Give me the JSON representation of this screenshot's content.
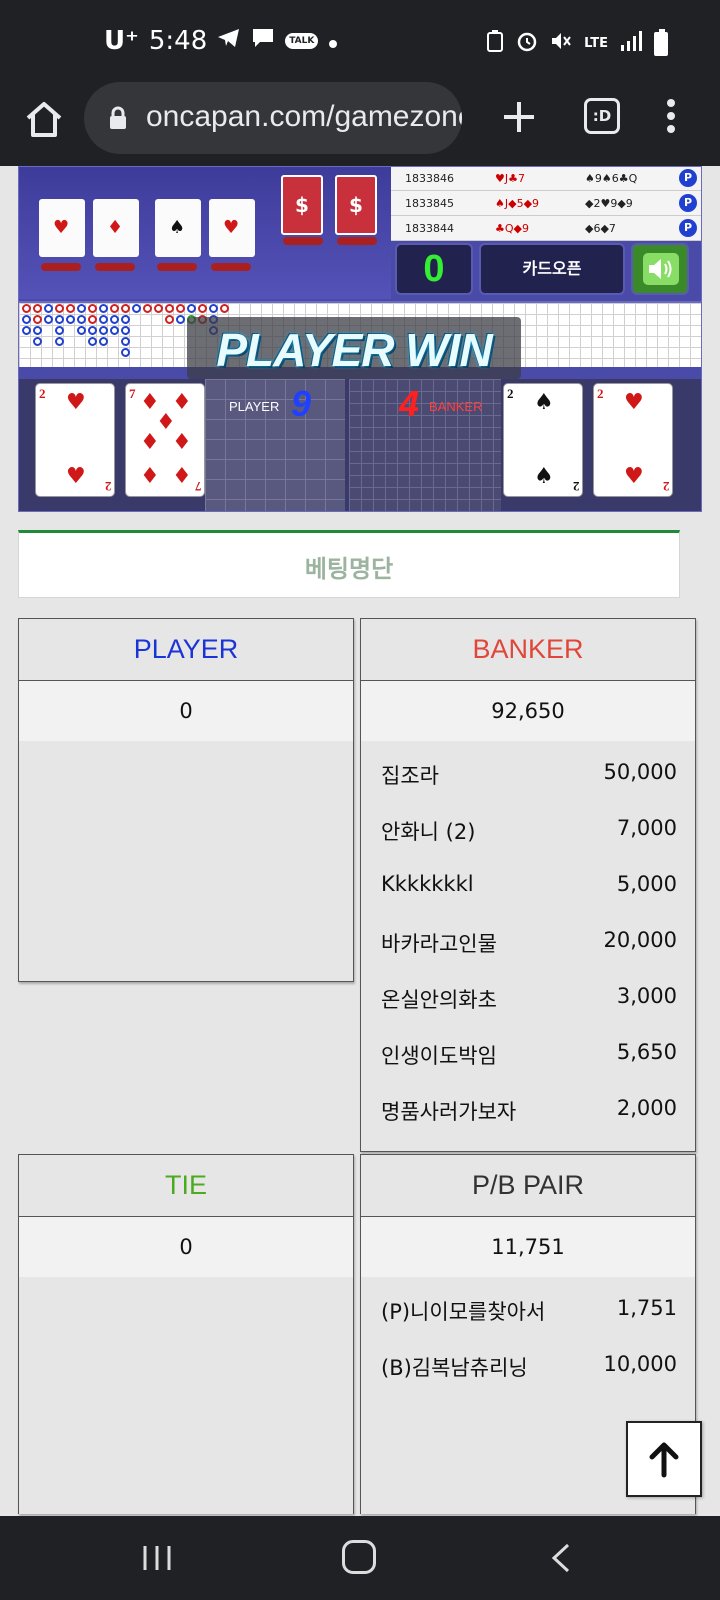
{
  "status_bar": {
    "carrier": "U⁺",
    "time": "5:48",
    "talk_badge": "TALK",
    "network": "LTE"
  },
  "browser": {
    "url": "oncapan.com/gamezone",
    "tab_count_label": ":D"
  },
  "game": {
    "history": [
      {
        "id": "1833846",
        "player": "♥J♣7",
        "banker": "♠9♠6♣Q",
        "badge": "P"
      },
      {
        "id": "1833845",
        "player": "♠J◆5◆9",
        "banker": "◆2♥9◆9",
        "badge": "P"
      },
      {
        "id": "1833844",
        "player": "♣Q◆9",
        "banker": "◆6◆7",
        "badge": "P"
      }
    ],
    "counter": "0",
    "card_open_label": "카드오픈",
    "win_text": "PLAYER WIN",
    "player_label": "PLAYER",
    "player_score": "9",
    "banker_label": "BANKER",
    "banker_score": "4",
    "player_cards": [
      {
        "rank": "2",
        "suit": "♥"
      },
      {
        "rank": "7",
        "suit": "♦"
      }
    ],
    "banker_cards": [
      {
        "rank": "2",
        "suit": "♠"
      },
      {
        "rank": "2",
        "suit": "♥"
      }
    ],
    "colors": {
      "player": "#1a34d8",
      "banker": "#e0473a",
      "tie": "#4caa1e",
      "pair": "#333333"
    }
  },
  "betting_list": {
    "title": "베팅명단",
    "player": {
      "title": "PLAYER",
      "total": "0",
      "entries": []
    },
    "banker": {
      "title": "BANKER",
      "total": "92,650",
      "entries": [
        {
          "name": "집조라",
          "amount": "50,000"
        },
        {
          "name": "안화니 (2)",
          "amount": "7,000"
        },
        {
          "name": "Kkkkkkkl",
          "amount": "5,000"
        },
        {
          "name": "바카라고인물",
          "amount": "20,000"
        },
        {
          "name": "온실안의화초",
          "amount": "3,000"
        },
        {
          "name": "인생이도박임",
          "amount": "5,650"
        },
        {
          "name": "명품사러가보자",
          "amount": "2,000"
        }
      ]
    },
    "tie": {
      "title": "TIE",
      "total": "0",
      "entries": []
    },
    "pair": {
      "title": "P/B PAIR",
      "total": "11,751",
      "entries": [
        {
          "name": "(P)니이모를찾아서",
          "amount": "1,751"
        },
        {
          "name": "(B)김복남츄리닝",
          "amount": "10,000"
        }
      ]
    }
  }
}
